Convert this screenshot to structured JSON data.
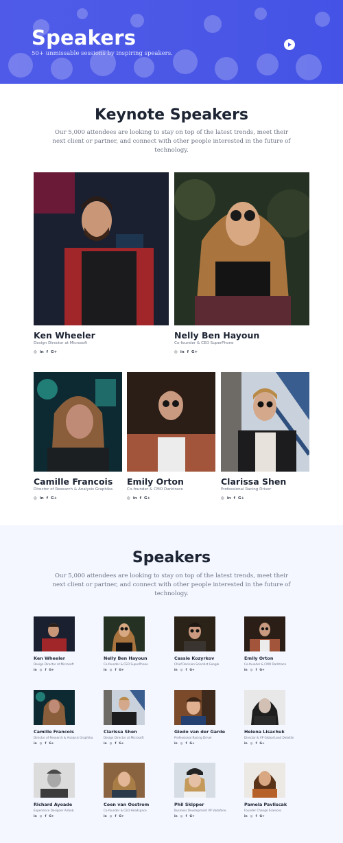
{
  "hero": {
    "title": "Speakers",
    "subtitle": "50+ unmissable sessions by inspiring speakers.",
    "play_icon": "play-icon",
    "accent": "#4a57e6"
  },
  "keynote": {
    "title": "Keynote Speakers",
    "description": "Our 5,000 attendees are looking to stay on top of the latest trends, meet their next client or partner, and connect with other people interested in the future of technology.",
    "speakers": [
      {
        "name": "Ken Wheeler",
        "role": "Design Director at Microsoft"
      },
      {
        "name": "Nelly Ben Hayoun",
        "role": "Co-founder & CEO SuperPhone"
      },
      {
        "name": "Camille Francois",
        "role": "Director of Research & Analysis Graphika"
      },
      {
        "name": "Emily Orton",
        "role": "Co-founder & CMO Darktrace"
      },
      {
        "name": "Clarissa Shen",
        "role": "Professional Racing Driver"
      }
    ]
  },
  "social_icons": {
    "large": [
      "github-icon",
      "linkedin-icon",
      "facebook-icon",
      "google-plus-icon"
    ],
    "large_glyphs": [
      "◎",
      "in",
      "f",
      "G+"
    ],
    "small": [
      "linkedin-icon",
      "github-icon",
      "facebook-icon",
      "google-plus-icon"
    ],
    "small_glyphs": [
      "in",
      "◎",
      "f",
      "G+"
    ]
  },
  "speakers": {
    "title": "Speakers",
    "description": "Our 5,000 attendees are looking to stay on top of the latest trends, meet their next client or partner, and connect with other people interested in the future of technology.",
    "list": [
      {
        "name": "Ken Wheeler",
        "role": "Design Director at Microsoft"
      },
      {
        "name": "Nelly Ben Hayoun",
        "role": "Co-founder & CEO SuperPhone"
      },
      {
        "name": "Cassie Kozyrkov",
        "role": "Chief Decision Scientist Google"
      },
      {
        "name": "Emily Orton",
        "role": "Co-founder & CMO Darktrace"
      },
      {
        "name": "Camille Francois",
        "role": "Director of Research & Analysis Graphika"
      },
      {
        "name": "Clarissa Shen",
        "role": "Design Director at Microsoft"
      },
      {
        "name": "Giedo van der Garde",
        "role": "Professional Racing Driver"
      },
      {
        "name": "Helena Lisachuk",
        "role": "Director & VP Global Lead Deloitte"
      },
      {
        "name": "Richard Ayoade",
        "role": "Experience Designer Airbnb"
      },
      {
        "name": "Coen van Oostrom",
        "role": "Co-founder & CEO Headspace"
      },
      {
        "name": "Phil Skipper",
        "role": "Business Development VP Vodafone"
      },
      {
        "name": "Pamela Pavliscak",
        "role": "Founder Change Sciences"
      }
    ]
  }
}
